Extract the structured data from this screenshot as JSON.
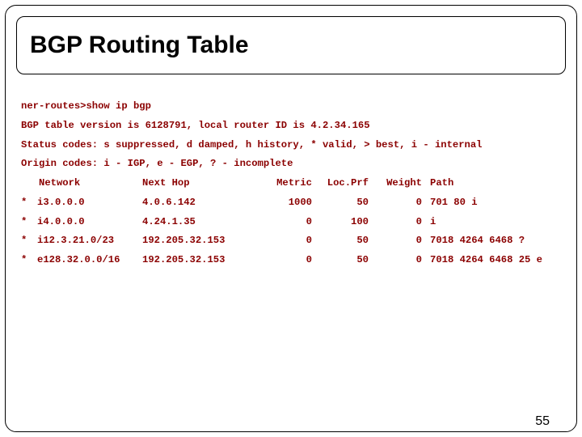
{
  "title": "BGP Routing Table",
  "prompt_line": "ner-routes>show ip bgp",
  "version_line": "BGP table version is 6128791, local router ID is 4.2.34.165",
  "status_line": "Status codes: s suppressed, d damped, h history, * valid, > best, i - internal",
  "origin_line": "Origin codes: i - IGP, e - EGP, ? - incomplete",
  "headers": {
    "network": "Network",
    "next_hop": "Next Hop",
    "metric": "Metric",
    "locprf": "Loc.Prf",
    "weight": "Weight",
    "path": "Path"
  },
  "rows": [
    {
      "sc": "*",
      "network": "i3.0.0.0",
      "next_hop": "4.0.6.142",
      "metric": "1000",
      "locprf": "50",
      "weight": "0",
      "path": "701 80 i"
    },
    {
      "sc": "*",
      "network": "i4.0.0.0",
      "next_hop": "4.24.1.35",
      "metric": "0",
      "locprf": "100",
      "weight": "0",
      "path": "i"
    },
    {
      "sc": "*",
      "network": "i12.3.21.0/23",
      "next_hop": "192.205.32.153",
      "metric": "0",
      "locprf": "50",
      "weight": "0",
      "path": "7018 4264 6468 ?"
    },
    {
      "sc": "*",
      "network": "e128.32.0.0/16",
      "next_hop": "192.205.32.153",
      "metric": "0",
      "locprf": "50",
      "weight": "0",
      "path": "7018 4264 6468 25 e"
    }
  ],
  "page_number": "55"
}
